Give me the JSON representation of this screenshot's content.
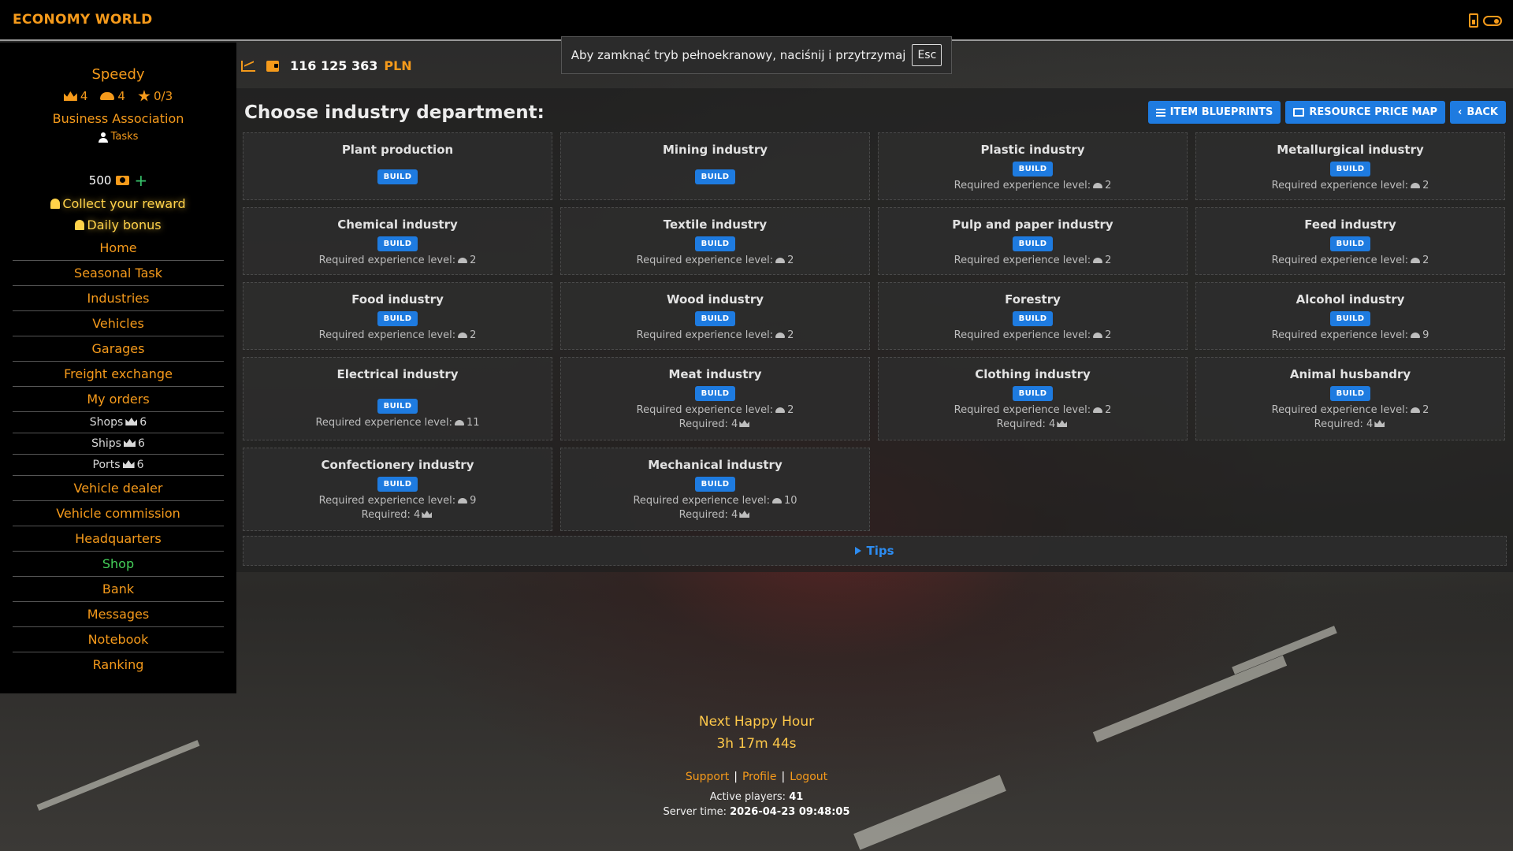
{
  "app": {
    "brand": "ECONOMY WORLD"
  },
  "notice": {
    "text": "Aby zamknąć tryb pełnoekranowy, naciśnij i przytrzymaj",
    "key": "Esc"
  },
  "money": {
    "amount": "116 125 363",
    "currency": "PLN"
  },
  "sidebar": {
    "username": "Speedy",
    "crowns": "4",
    "helmets": "4",
    "stars": "0/3",
    "association": "Business Association",
    "tasks": "Tasks",
    "gold": "500",
    "reward": "Collect your reward",
    "bonus": "Daily bonus",
    "nav": {
      "home": "Home",
      "seasonal": "Seasonal Task",
      "industries": "Industries",
      "vehicles": "Vehicles",
      "garages": "Garages",
      "freight": "Freight exchange",
      "orders": "My orders",
      "shops": "Shops",
      "shops_req": "6",
      "ships": "Ships",
      "ships_req": "6",
      "ports": "Ports",
      "ports_req": "6",
      "dealer": "Vehicle dealer",
      "commission": "Vehicle commission",
      "hq": "Headquarters",
      "shop": "Shop",
      "bank": "Bank",
      "messages": "Messages",
      "notebook": "Notebook",
      "ranking": "Ranking"
    }
  },
  "main": {
    "title": "Choose industry department:",
    "actions": {
      "blueprints": "ITEM BLUEPRINTS",
      "price_map": "RESOURCE PRICE MAP",
      "back": "BACK"
    },
    "build_label": "BUILD",
    "req_label": "Required experience level:",
    "req_crown_label": "Required: 4",
    "cards": [
      {
        "name": "Plant production"
      },
      {
        "name": "Mining industry"
      },
      {
        "name": "Plastic industry",
        "level": "2"
      },
      {
        "name": "Metallurgical industry",
        "level": "2"
      },
      {
        "name": "Chemical industry",
        "level": "2"
      },
      {
        "name": "Textile industry",
        "level": "2"
      },
      {
        "name": "Pulp and paper industry",
        "level": "2"
      },
      {
        "name": "Feed industry",
        "level": "2"
      },
      {
        "name": "Food industry",
        "level": "2"
      },
      {
        "name": "Wood industry",
        "level": "2"
      },
      {
        "name": "Forestry",
        "level": "2"
      },
      {
        "name": "Alcohol industry",
        "level": "9"
      },
      {
        "name": "Electrical industry",
        "level": "11"
      },
      {
        "name": "Meat industry",
        "level": "2"
      },
      {
        "name": "Clothing industry",
        "level": "2"
      },
      {
        "name": "Animal husbandry",
        "level": "2"
      },
      {
        "name": "Confectionery industry",
        "level": "9"
      },
      {
        "name": "Mechanical industry",
        "level": "10"
      }
    ],
    "tips": "Tips"
  },
  "footer": {
    "happy_title": "Next Happy Hour",
    "happy_time": "3h 17m 44s",
    "support": "Support",
    "profile": "Profile",
    "logout": "Logout",
    "players_label": "Active players:",
    "players": "41",
    "server_label": "Server time:",
    "server_time": "2026-04-23 09:48:05"
  },
  "colors": {
    "accent": "#f59a1b",
    "button": "#1e7be0",
    "shop": "#45d15a",
    "gold": "#ffd24a"
  }
}
